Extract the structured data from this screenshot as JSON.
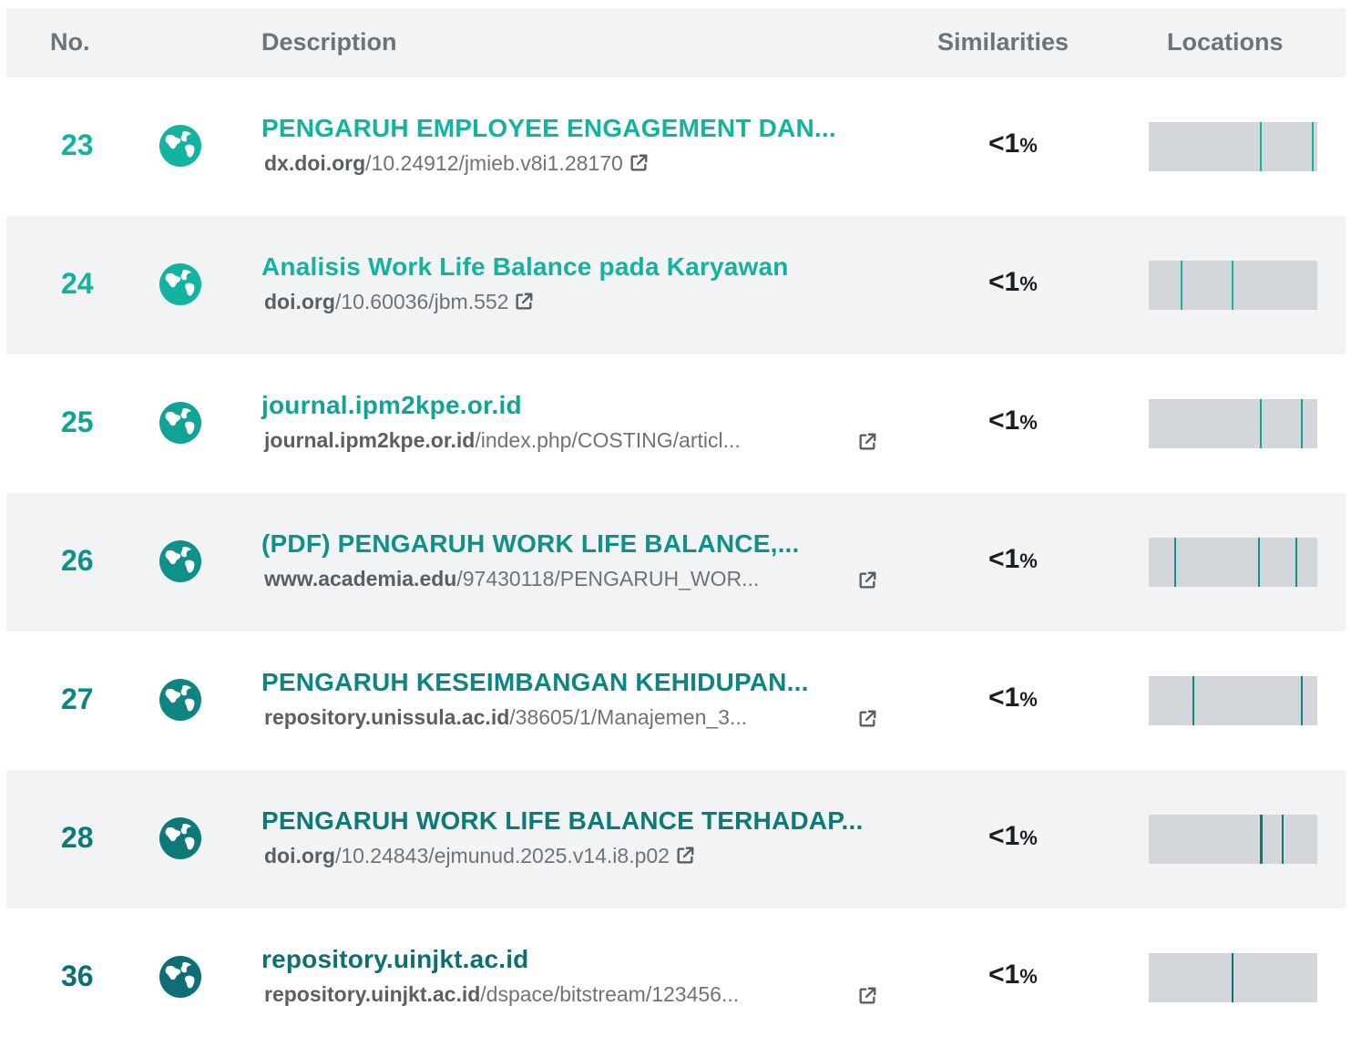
{
  "header": {
    "no": "No.",
    "description": "Description",
    "similarities": "Similarities",
    "locations": "Locations"
  },
  "colors": {
    "teal_light": "#12b39f",
    "teal_mid": "#0f8f86",
    "teal_dark": "#0d6f73",
    "bar_bg": "#d3d7dc"
  },
  "rows": [
    {
      "no": "23",
      "icon": "globe-icon",
      "title": "PENGARUH EMPLOYEE ENGAGEMENT DAN...",
      "domain": "dx.doi.org",
      "path": "/10.24912/jmieb.v8i1.28170",
      "similarity": "<1",
      "percent_sign": "%",
      "color": "#12b39f",
      "locations": [
        0.66,
        0.97
      ]
    },
    {
      "no": "24",
      "icon": "globe-icon",
      "title": "Analisis Work Life Balance pada Karyawan",
      "domain": "doi.org",
      "path": "/10.60036/jbm.552",
      "similarity": "<1",
      "percent_sign": "%",
      "color": "#12b39f",
      "locations": [
        0.19,
        0.49
      ]
    },
    {
      "no": "25",
      "icon": "globe-icon",
      "title": "journal.ipm2kpe.or.id",
      "domain": "journal.ipm2kpe.or.id",
      "path": "/index.php/COSTING/articl...",
      "similarity": "<1",
      "percent_sign": "%",
      "color": "#10a396",
      "locations": [
        0.66,
        0.9
      ]
    },
    {
      "no": "26",
      "icon": "globe-icon",
      "title": "(PDF) PENGARUH WORK LIFE BALANCE,...",
      "domain": "www.academia.edu",
      "path": "/97430118/PENGARUH_WOR...",
      "similarity": "<1",
      "percent_sign": "%",
      "color": "#0f918a",
      "locations": [
        0.15,
        0.65,
        0.87
      ]
    },
    {
      "no": "27",
      "icon": "globe-icon",
      "title": "PENGARUH KESEIMBANGAN KEHIDUPAN...",
      "domain": "repository.unissula.ac.id",
      "path": "/38605/1/Manajemen_3...",
      "similarity": "<1",
      "percent_sign": "%",
      "color": "#0e8581",
      "locations": [
        0.26,
        0.9
      ]
    },
    {
      "no": "28",
      "icon": "globe-icon",
      "title": "PENGARUH WORK LIFE BALANCE TERHADAP...",
      "domain": "doi.org",
      "path": "/10.24843/ejmunud.2025.v14.i8.p02",
      "similarity": "<1",
      "percent_sign": "%",
      "color": "#0d7a78",
      "locations": [
        0.66,
        0.79
      ]
    },
    {
      "no": "36",
      "icon": "globe-icon",
      "title": "repository.uinjkt.ac.id",
      "domain": "repository.uinjkt.ac.id",
      "path": "/dspace/bitstream/123456...",
      "similarity": "<1",
      "percent_sign": "%",
      "color": "#0d6f73",
      "locations": [
        0.49
      ]
    }
  ]
}
